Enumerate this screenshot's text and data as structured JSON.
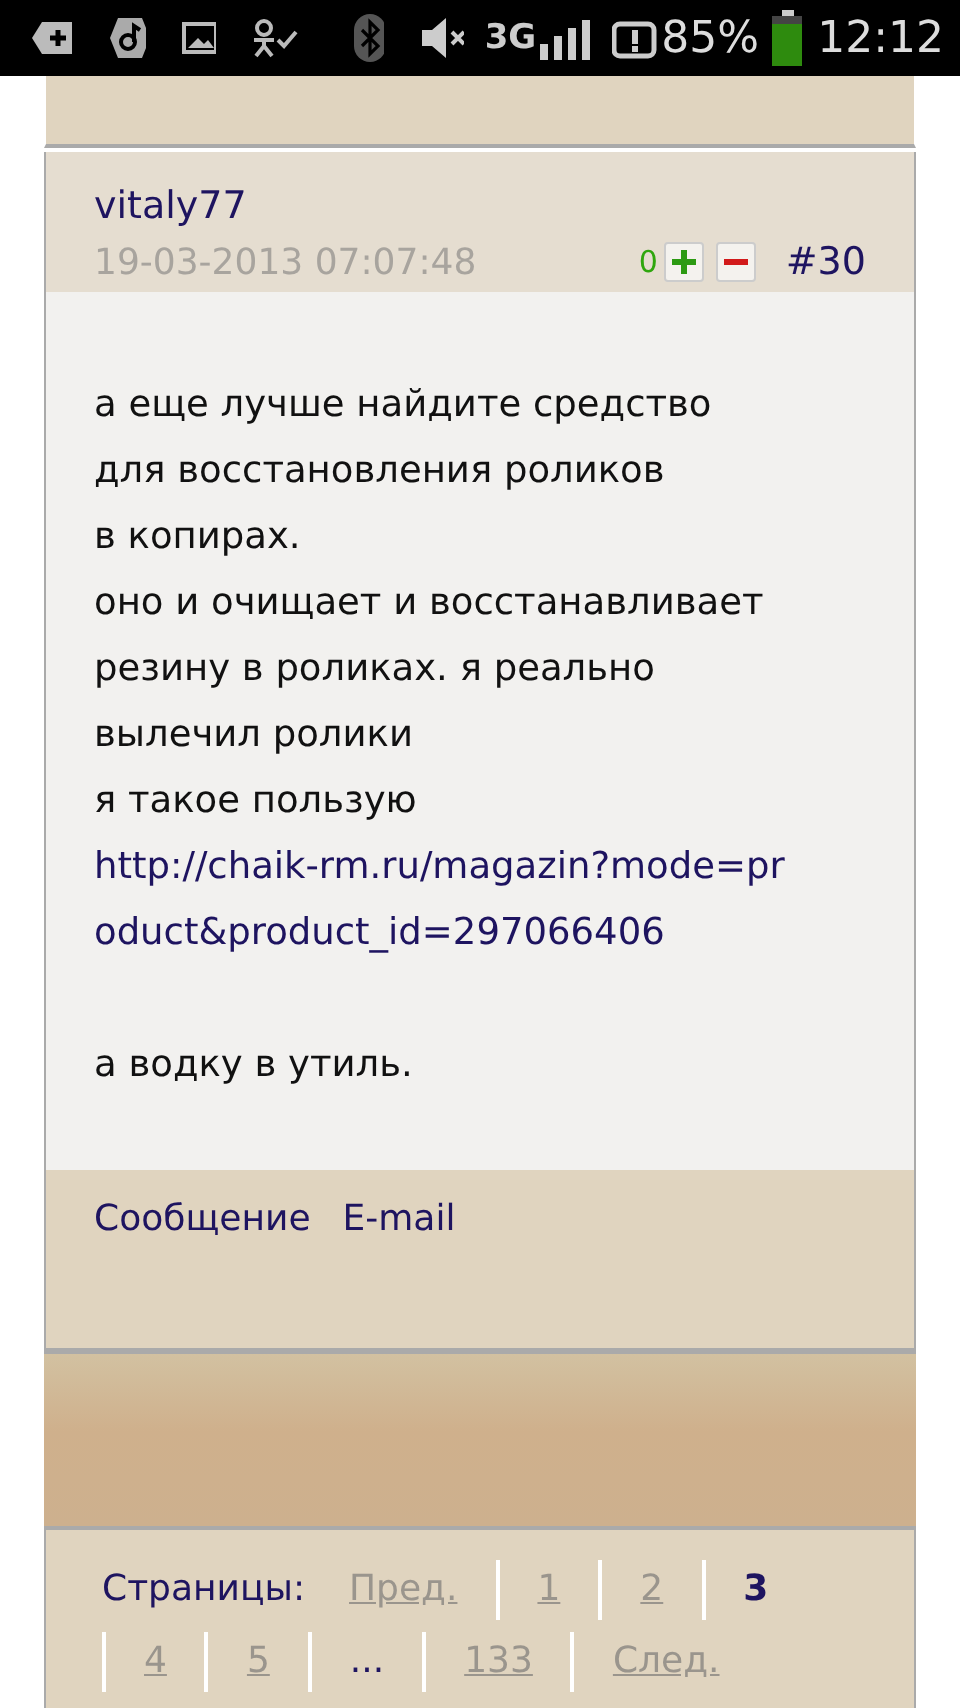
{
  "status_bar": {
    "network": "3G",
    "battery": "85%",
    "time": "12:12"
  },
  "post": {
    "author": "vitaly77",
    "date": "19-03-2013 07:07:48",
    "rating": "0",
    "number": "#30",
    "body": [
      {
        "kind": "text",
        "text": "а еще лучше найдите средство"
      },
      {
        "kind": "text",
        "text": "для восстановления роликов"
      },
      {
        "kind": "text",
        "text": "в копирах."
      },
      {
        "kind": "text",
        "text": "оно и очищает и восстанавливает"
      },
      {
        "kind": "text",
        "text": "резину в роликах. я реально"
      },
      {
        "kind": "text",
        "text": "вылечил ролики"
      },
      {
        "kind": "text",
        "text": "я такое пользую"
      },
      {
        "kind": "link",
        "text": "http://chaik-rm.ru/magazin?mode=product&product_id=297066406"
      },
      {
        "kind": "blank"
      },
      {
        "kind": "text",
        "text": "а водку в утиль."
      }
    ],
    "actions": [
      "Сообщение",
      "E-mail"
    ]
  },
  "pagination": {
    "label": "Страницы:",
    "items": [
      {
        "kind": "link",
        "text": "Пред.",
        "selected": false
      },
      {
        "kind": "link",
        "text": "1",
        "selected": false
      },
      {
        "kind": "link",
        "text": "2",
        "selected": false
      },
      {
        "kind": "link",
        "text": "3",
        "selected": true
      },
      {
        "kind": "link",
        "text": "4",
        "selected": false
      },
      {
        "kind": "link",
        "text": "5",
        "selected": false
      },
      {
        "kind": "gap",
        "text": "..."
      },
      {
        "kind": "link",
        "text": "133",
        "selected": false
      },
      {
        "kind": "link",
        "text": "След.",
        "selected": false
      }
    ]
  }
}
